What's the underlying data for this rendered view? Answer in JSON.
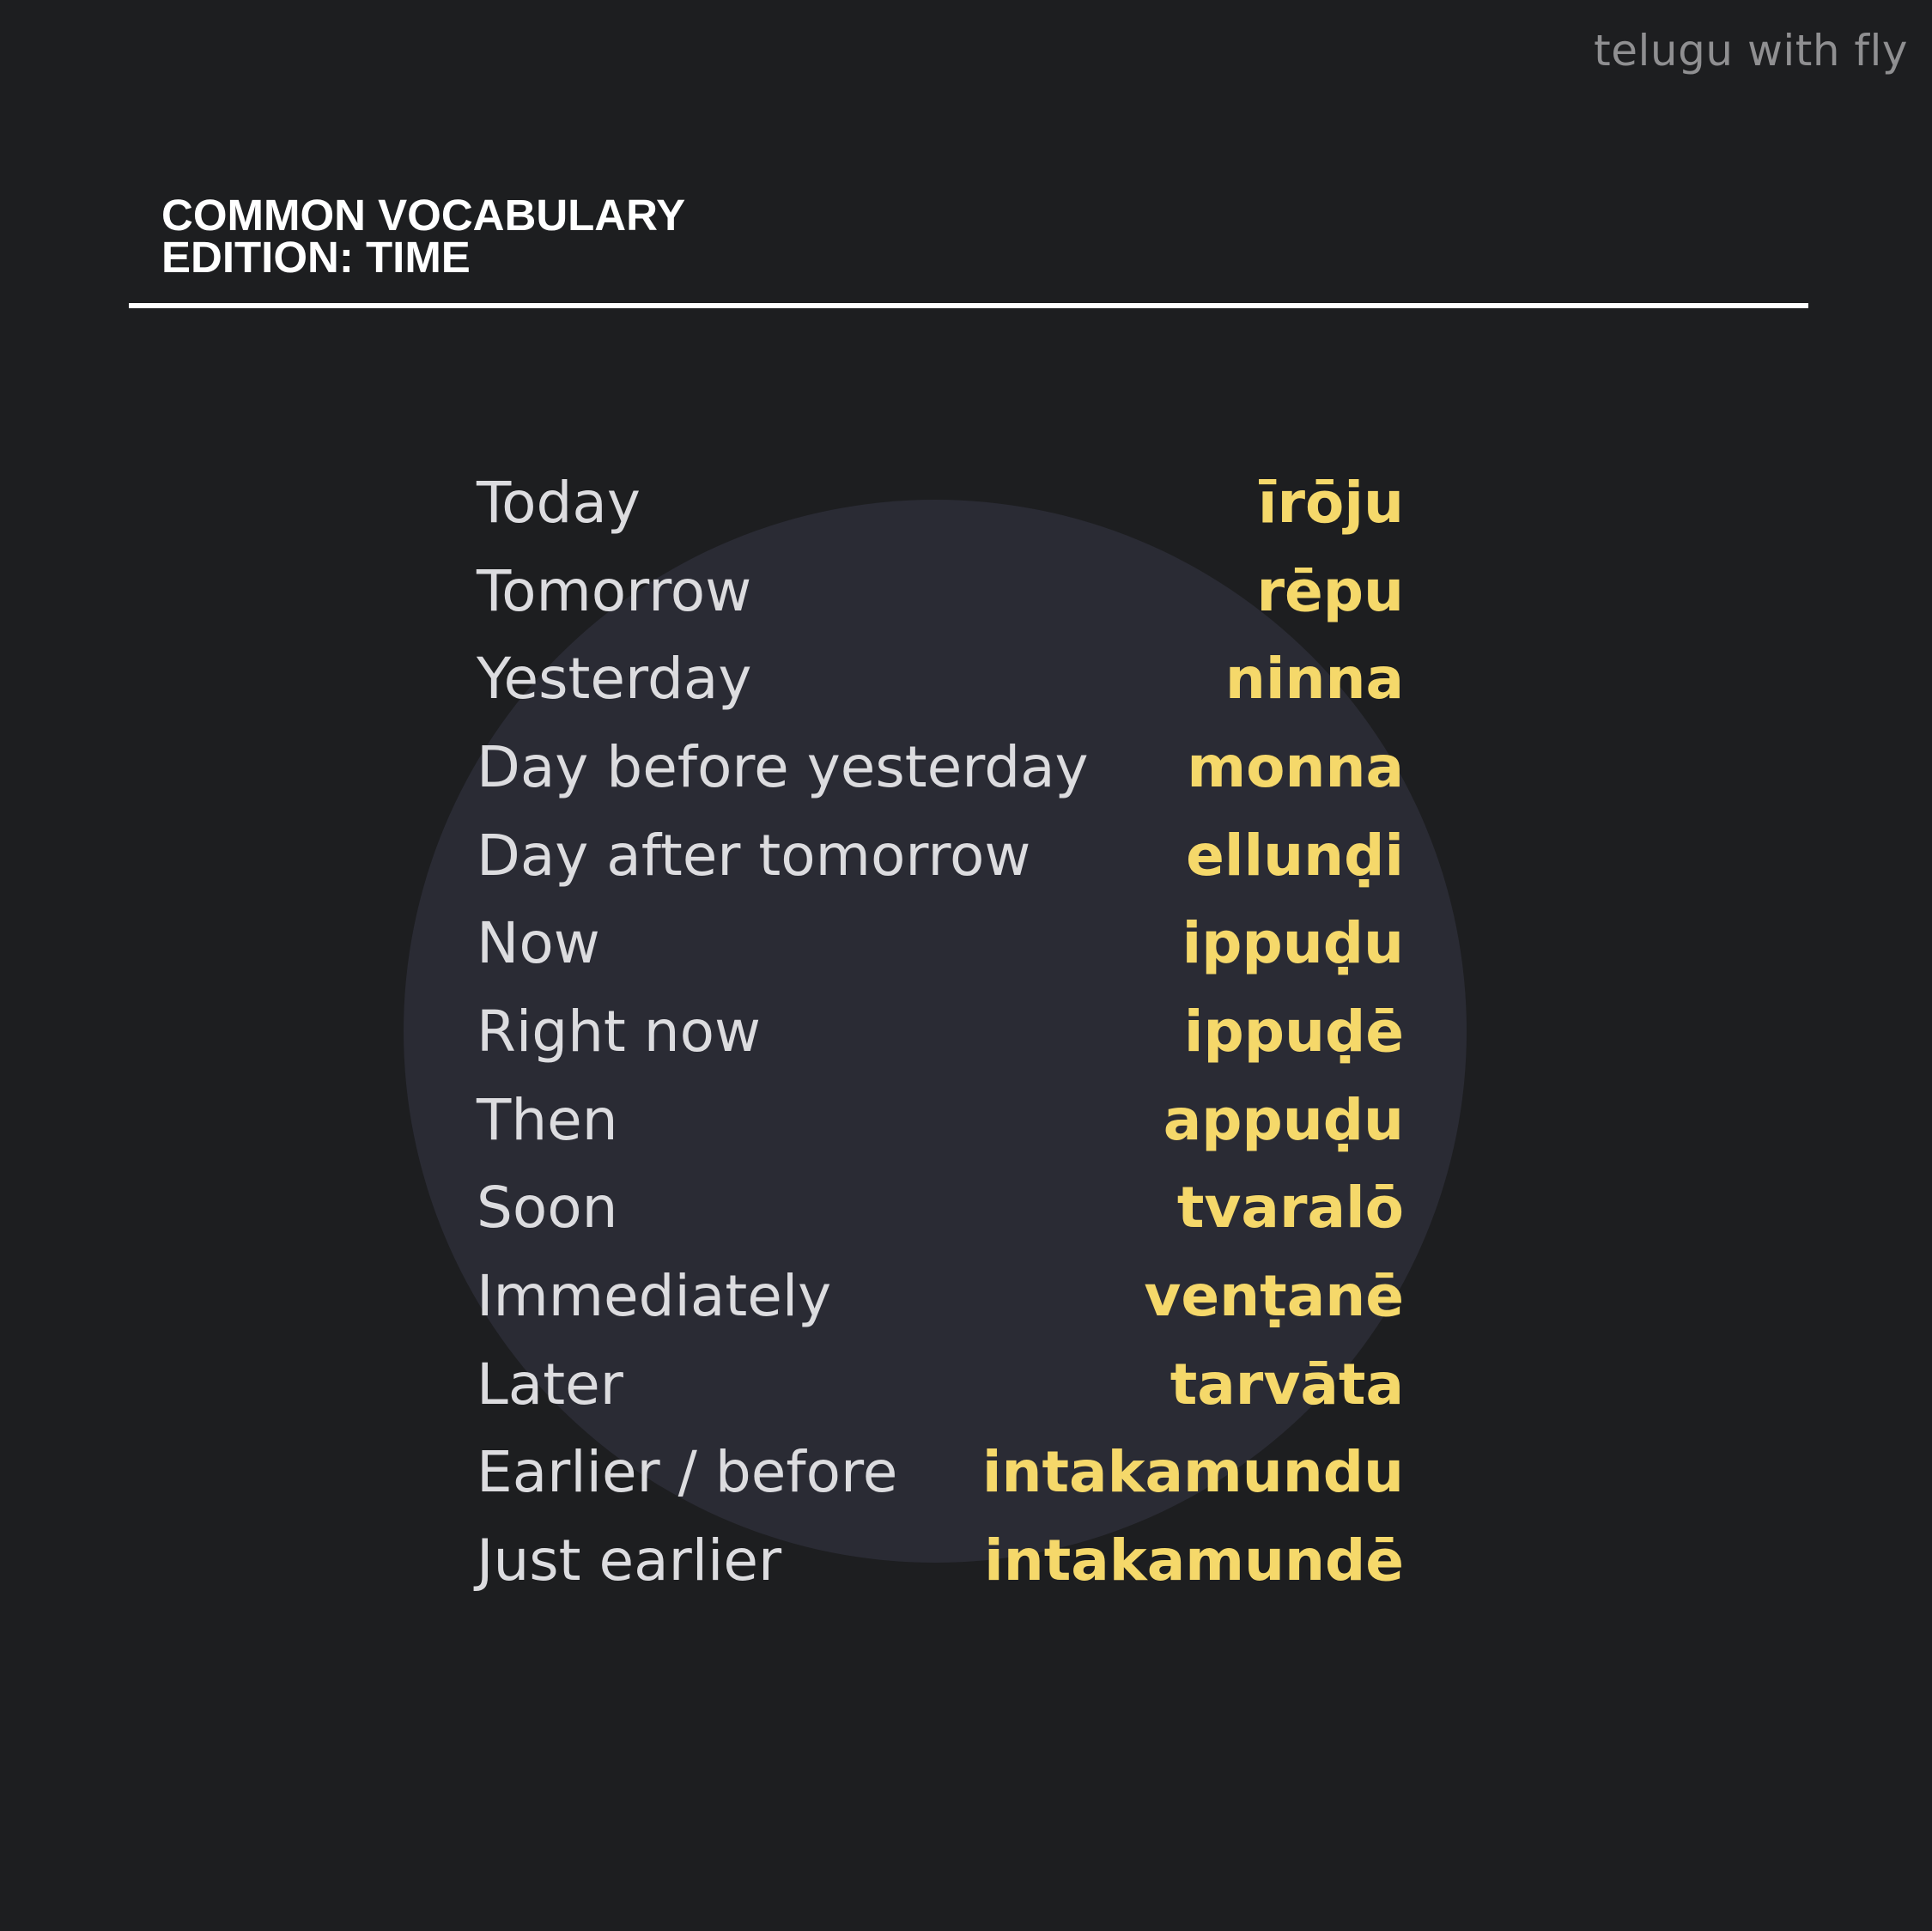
{
  "brand": "telugu with fly",
  "header": {
    "line1": "COMMON VOCABULARY",
    "line2": "EDITION: TIME"
  },
  "colors": {
    "background": "#1d1e20",
    "circle": "#2a2b34",
    "english_text": "#dcdcdf",
    "telugu_text": "#f5d86a",
    "brand_text": "#8f8f91"
  },
  "vocabulary": [
    {
      "english": "Today",
      "telugu": "īrōju"
    },
    {
      "english": "Tomorrow",
      "telugu": "rēpu"
    },
    {
      "english": "Yesterday",
      "telugu": "ninna"
    },
    {
      "english": "Day before yesterday",
      "telugu": "monna"
    },
    {
      "english": "Day after tomorrow",
      "telugu": "ellunḍi"
    },
    {
      "english": "Now",
      "telugu": "ippuḍu"
    },
    {
      "english": "Right now",
      "telugu": "ippuḍē"
    },
    {
      "english": "Then",
      "telugu": "appuḍu"
    },
    {
      "english": "Soon",
      "telugu": "tvaralō"
    },
    {
      "english": "Immediately",
      "telugu": "venṭanē"
    },
    {
      "english": "Later",
      "telugu": "tarvāta"
    },
    {
      "english": "Earlier / before",
      "telugu": "intakamundu"
    },
    {
      "english": "Just earlier",
      "telugu": "intakamundē"
    }
  ]
}
